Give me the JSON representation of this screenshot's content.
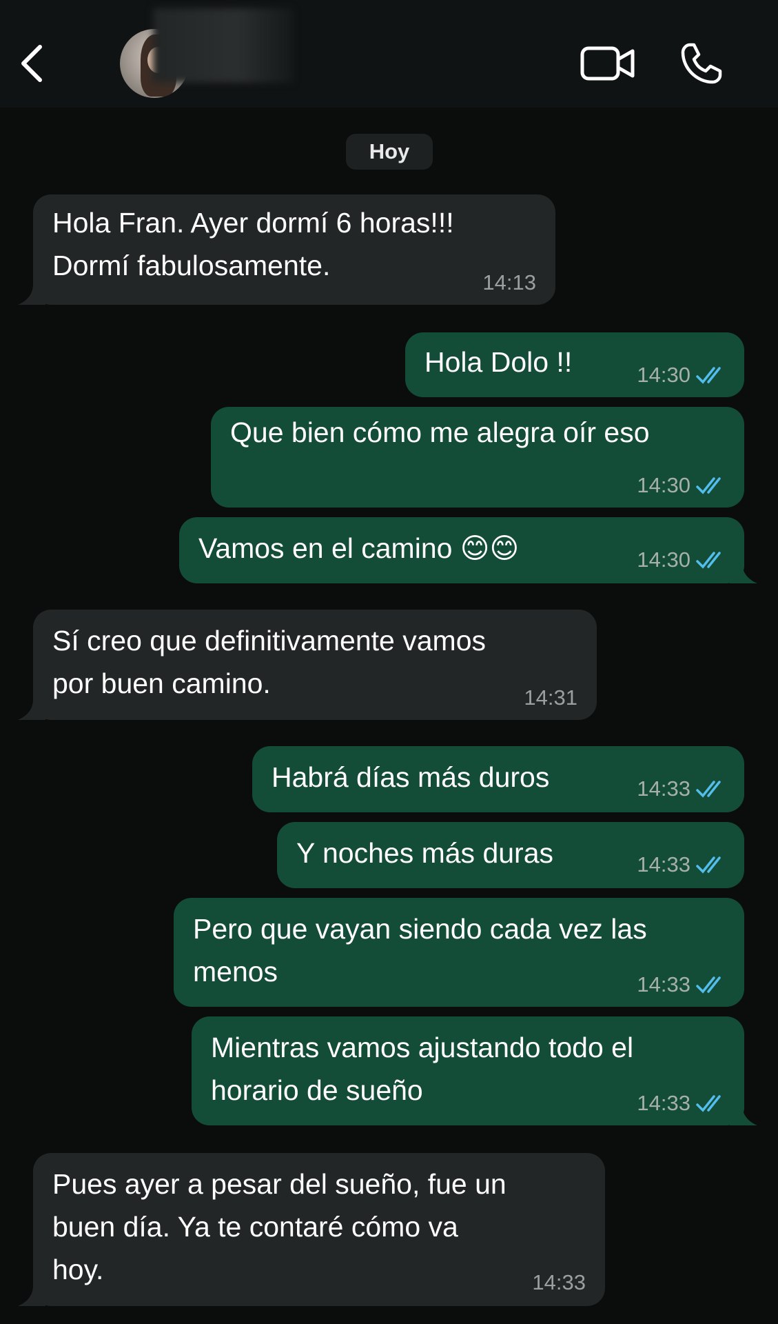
{
  "header": {
    "back_icon": "chevron-left-icon",
    "contact_name": "",
    "video_icon": "video-camera-icon",
    "call_icon": "phone-icon"
  },
  "date_divider": "Hoy",
  "colors": {
    "incoming_bubble": "#232626",
    "outgoing_bubble": "#144d37",
    "read_ticks": "#53bdeb",
    "background": "#0b0c0c"
  },
  "messages": [
    {
      "direction": "in",
      "text": "Hola Fran. Ayer dormí 6 horas!!!\nDormí fabulosamente.",
      "time": "14:13"
    },
    {
      "direction": "out",
      "text": "Hola Dolo !!",
      "time": "14:30",
      "status": "read"
    },
    {
      "direction": "out",
      "text": "Que bien cómo me alegra oír eso",
      "time": "14:30",
      "status": "read"
    },
    {
      "direction": "out",
      "text": "Vamos en el camino 😊😊",
      "time": "14:30",
      "status": "read"
    },
    {
      "direction": "in",
      "text": "Sí creo que definitivamente vamos\npor buen camino.",
      "time": "14:31"
    },
    {
      "direction": "out",
      "text": "Habrá días más duros",
      "time": "14:33",
      "status": "read"
    },
    {
      "direction": "out",
      "text": "Y noches más duras",
      "time": "14:33",
      "status": "read"
    },
    {
      "direction": "out",
      "text": "Pero que vayan siendo cada vez las\nmenos",
      "time": "14:33",
      "status": "read"
    },
    {
      "direction": "out",
      "text": "Mientras vamos ajustando todo el\nhorario de sueño",
      "time": "14:33",
      "status": "read"
    },
    {
      "direction": "in",
      "text": "Pues ayer a pesar del sueño, fue un\nbuen día. Ya te contaré cómo va\nhoy.",
      "time": "14:33"
    }
  ]
}
